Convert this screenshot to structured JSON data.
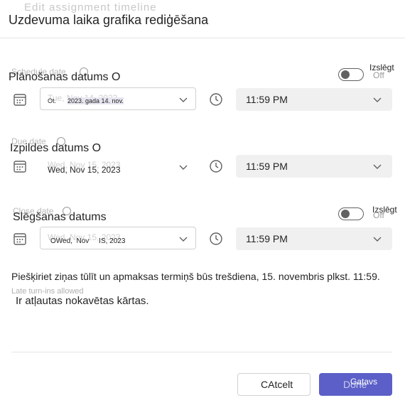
{
  "dialog": {
    "title": "Uzdevuma laika grafika rediģēšana",
    "title_ghost": "Edit assignment timeline"
  },
  "schedule": {
    "ghost_label": "Schedule date",
    "label": "Plānošanas datums O",
    "toggle_label": "Izslēgt",
    "toggle_ghost": "Off",
    "toggle_on": false,
    "date_ghost": "Tue, Nov 14, 2023",
    "date_prefix": "Ot.",
    "date_value": "2023. gada 14. nov.",
    "time_value": "11:59 PM"
  },
  "due": {
    "ghost_label": "Due date",
    "label": "Izpildes datums O",
    "date_ghost": "Wed, Nov 15, 2023",
    "date_value": "Wed, Nov 15, 2023",
    "time_value": "11:59 PM"
  },
  "close": {
    "ghost_label": "Close date",
    "label": "Slēgšanas datums",
    "toggle_label": "Izslēgt",
    "toggle_ghost": "Off",
    "toggle_on": false,
    "date_ghost": "Wed, Nov 15, 2023",
    "date_value": "OWed,  Nov     IS, 2023",
    "time_value": "11:59 PM"
  },
  "note": "Piešķiriet ziņas tūlīt un apmaksas termiņš būs trešdiena, 15. novembris plkst. 11:59.",
  "note_ghost": "Late turn-ins allowed",
  "late_text": "Ir atļautas nokavētas kārtas.",
  "buttons": {
    "cancel": "CAtcelt",
    "done_ghost": "Done",
    "done": "Gatavs"
  },
  "colors": {
    "accent": "#5b5fc7",
    "time_field_bg": "#f0f0f0"
  }
}
